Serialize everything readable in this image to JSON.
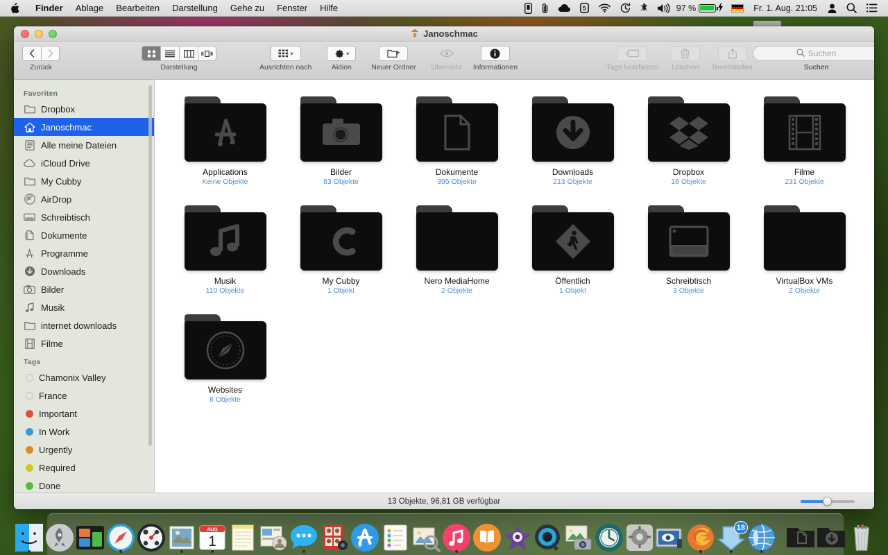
{
  "menubar": {
    "apple_icon": "apple-logo",
    "items": [
      {
        "label": "Finder",
        "bold": true
      },
      {
        "label": "Ablage",
        "bold": false
      },
      {
        "label": "Bearbeiten",
        "bold": false
      },
      {
        "label": "Darstellung",
        "bold": false
      },
      {
        "label": "Gehe zu",
        "bold": false
      },
      {
        "label": "Fenster",
        "bold": false
      },
      {
        "label": "Hilfe",
        "bold": false
      }
    ],
    "status_icons": [
      "iphone-icon",
      "paperclip-icon",
      "cloud-icon",
      "shield-5-icon",
      "wifi-icon",
      "timemachine-icon",
      "bluetooth-icon",
      "volume-icon"
    ],
    "battery_percent": "97 %",
    "battery_level": 94,
    "charging_icon": "lightning-bolt-icon",
    "flag": "german-flag-icon",
    "clock": "Fr. 1. Aug.  21:05",
    "right_icons": [
      "user-icon",
      "spotlight-search-icon",
      "notification-center-icon"
    ]
  },
  "window": {
    "title": "Janoschmac",
    "title_icon": "home-folder-icon",
    "traffic_lights": [
      "close-button",
      "minimize-button",
      "zoom-button"
    ]
  },
  "toolbar": {
    "back_label": "Zurück",
    "back_icon": "chevron-left-icon",
    "forward_icon": "chevron-right-icon",
    "view_label": "Darstellung",
    "view_modes": [
      "icon-view",
      "list-view",
      "column-view",
      "coverflow-view"
    ],
    "view_active_index": 0,
    "arrange_label": "Ausrichten nach",
    "arrange_icon": "grid-icon",
    "action_label": "Aktion",
    "action_icon": "gear-icon",
    "newfolder_label": "Neuer Ordner",
    "newfolder_icon": "new-folder-icon",
    "quicklook_label": "Übersicht",
    "quicklook_icon": "eye-icon",
    "info_label": "Informationen",
    "info_icon": "info-circle-icon",
    "tags_label": "Tags bearbeiten",
    "tags_icon": "tag-icon",
    "delete_label": "Löschen",
    "delete_icon": "trash-icon",
    "share_label": "Bereitstellen",
    "share_icon": "share-icon",
    "search_placeholder": "Suchen",
    "search_caption": "Suchen",
    "search_icon": "magnifier-icon"
  },
  "sidebar": {
    "sections": [
      {
        "header": "Favoriten",
        "items": [
          {
            "label": "Dropbox",
            "icon": "folder-icon",
            "selected": false
          },
          {
            "label": "Janoschmac",
            "icon": "home-icon",
            "selected": true
          },
          {
            "label": "Alle meine Dateien",
            "icon": "all-files-icon",
            "selected": false
          },
          {
            "label": "iCloud Drive",
            "icon": "cloud-icon",
            "selected": false
          },
          {
            "label": "My Cubby",
            "icon": "folder-icon",
            "selected": false
          },
          {
            "label": "AirDrop",
            "icon": "airdrop-icon",
            "selected": false
          },
          {
            "label": "Schreibtisch",
            "icon": "desktop-icon",
            "selected": false
          },
          {
            "label": "Dokumente",
            "icon": "documents-icon",
            "selected": false
          },
          {
            "label": "Programme",
            "icon": "applications-icon",
            "selected": false
          },
          {
            "label": "Downloads",
            "icon": "downloads-icon",
            "selected": false
          },
          {
            "label": "Bilder",
            "icon": "camera-icon",
            "selected": false
          },
          {
            "label": "Musik",
            "icon": "music-note-icon",
            "selected": false
          },
          {
            "label": "internet downloads",
            "icon": "folder-icon",
            "selected": false
          },
          {
            "label": "Filme",
            "icon": "film-icon",
            "selected": false
          }
        ]
      },
      {
        "header": "Tags",
        "items": [
          {
            "label": "Chamonix Valley",
            "icon": "tag-dot-icon",
            "color": "#d9d9d9"
          },
          {
            "label": "France",
            "icon": "tag-dot-icon",
            "color": "#d9d9d9"
          },
          {
            "label": "Important",
            "icon": "tag-dot-icon",
            "color": "#e0503f"
          },
          {
            "label": "In Work",
            "icon": "tag-dot-icon",
            "color": "#3d9ad6"
          },
          {
            "label": "Urgently",
            "icon": "tag-dot-icon",
            "color": "#e08a1e"
          },
          {
            "label": "Required",
            "icon": "tag-dot-icon",
            "color": "#d6c425"
          },
          {
            "label": "Done",
            "icon": "tag-dot-icon",
            "color": "#58bb3c"
          }
        ]
      }
    ]
  },
  "files": [
    {
      "name": "Applications",
      "count": "Keine Objekte",
      "icon": "app-store-folder-icon"
    },
    {
      "name": "Bilder",
      "count": "83 Objekte",
      "icon": "camera-folder-icon"
    },
    {
      "name": "Dokumente",
      "count": "395 Objekte",
      "icon": "document-folder-icon"
    },
    {
      "name": "Downloads",
      "count": "213 Objekte",
      "icon": "downloads-folder-icon"
    },
    {
      "name": "Dropbox",
      "count": "16 Objekte",
      "icon": "dropbox-folder-icon"
    },
    {
      "name": "Filme",
      "count": "231 Objekte",
      "icon": "film-folder-icon"
    },
    {
      "name": "Musik",
      "count": "110 Objekte",
      "icon": "music-folder-icon"
    },
    {
      "name": "My Cubby",
      "count": "1 Objekt",
      "icon": "cubby-folder-icon"
    },
    {
      "name": "Nero MediaHome",
      "count": "2 Objekte",
      "icon": "plain-folder-icon"
    },
    {
      "name": "Öffentlich",
      "count": "1 Objekt",
      "icon": "public-folder-icon"
    },
    {
      "name": "Schreibtisch",
      "count": "3 Objekte",
      "icon": "desktop-folder-icon"
    },
    {
      "name": "VirtualBox VMs",
      "count": "2 Objekte",
      "icon": "plain-folder-icon"
    },
    {
      "name": "Websites",
      "count": "8 Objekte",
      "icon": "safari-folder-icon"
    }
  ],
  "statusbar": {
    "text": "13 Objekte, 96,81 GB verfügbar",
    "zoom_value": 45
  },
  "dock": {
    "items": [
      {
        "name": "Finder",
        "icon": "finder-icon",
        "running": true
      },
      {
        "name": "Launchpad",
        "icon": "launchpad-icon",
        "running": false
      },
      {
        "name": "Mission Control",
        "icon": "mission-control-icon",
        "running": false
      },
      {
        "name": "Safari",
        "icon": "safari-icon",
        "running": true
      },
      {
        "name": "Dashboard",
        "icon": "dashboard-icon",
        "running": false
      },
      {
        "name": "Mail",
        "icon": "mail-icon",
        "running": true
      },
      {
        "name": "Kalender",
        "icon": "calendar-icon",
        "running": true,
        "month": "AUG",
        "day": "1"
      },
      {
        "name": "Notizen",
        "icon": "notes-icon",
        "running": false
      },
      {
        "name": "Kontakte",
        "icon": "contacts-icon",
        "running": false
      },
      {
        "name": "Nachrichten",
        "icon": "messages-icon",
        "running": true
      },
      {
        "name": "Photo Booth",
        "icon": "photobooth-icon",
        "running": false
      },
      {
        "name": "App Store",
        "icon": "appstore-icon",
        "running": false
      },
      {
        "name": "Erinnerungen",
        "icon": "reminders-icon",
        "running": false
      },
      {
        "name": "Vorschau",
        "icon": "preview-icon",
        "running": false
      },
      {
        "name": "iTunes",
        "icon": "itunes-icon",
        "running": true
      },
      {
        "name": "iBooks",
        "icon": "ibooks-icon",
        "running": false
      },
      {
        "name": "iMovie",
        "icon": "imovie-icon",
        "running": false
      },
      {
        "name": "QuickTime Player",
        "icon": "quicktime-icon",
        "running": false
      },
      {
        "name": "Digitale Bilder",
        "icon": "image-capture-icon",
        "running": false
      },
      {
        "name": "Time Machine",
        "icon": "timemachine-icon",
        "running": false
      },
      {
        "name": "Systemeinstellungen",
        "icon": "system-preferences-icon",
        "running": false
      },
      {
        "name": "Bildschirmfreigabe",
        "icon": "screen-sharing-icon",
        "running": false
      },
      {
        "name": "Firefox",
        "icon": "firefox-icon",
        "running": true
      },
      {
        "name": "Downloader",
        "icon": "download-arrow-icon",
        "running": true,
        "badge": "18"
      },
      {
        "name": "Browser",
        "icon": "globe-icon",
        "running": true
      }
    ],
    "stack_items": [
      {
        "name": "Dokumente",
        "icon": "documents-stack-icon"
      },
      {
        "name": "Downloads",
        "icon": "downloads-stack-icon"
      }
    ],
    "trash": {
      "name": "Papierkorb",
      "icon": "trash-icon"
    }
  }
}
